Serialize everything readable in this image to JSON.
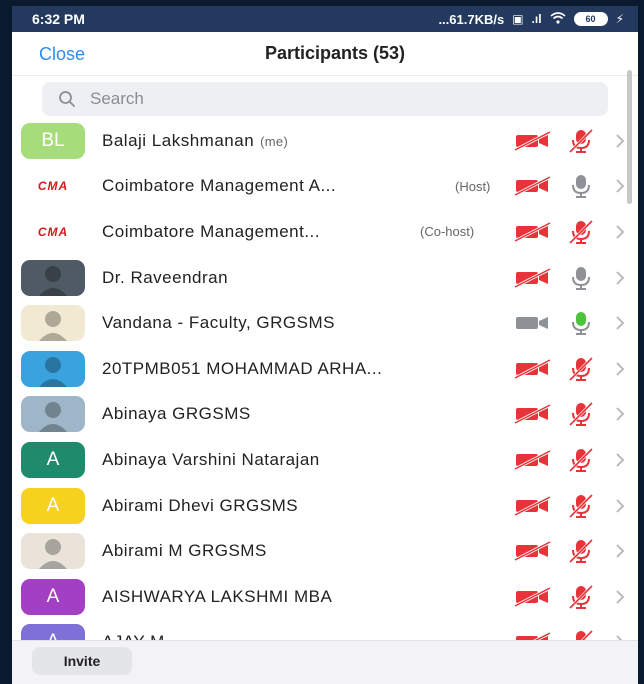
{
  "status": {
    "time": "6:32 PM",
    "network": "...61.7KB/s",
    "battery": "60"
  },
  "header": {
    "close_label": "Close",
    "title": "Participants (53)"
  },
  "search": {
    "placeholder": "Search"
  },
  "participants": [
    {
      "avatar": "BL",
      "avatar_color": "#a6dd7a",
      "name": "Balaji Lakshmanan",
      "tag": "(me)",
      "video": "off",
      "audio": "muted"
    },
    {
      "avatar": "CMA",
      "avatar_color": "#ffffff",
      "name": "Coimbatore Management A...",
      "tag": "(Host)",
      "video": "off",
      "audio": "on"
    },
    {
      "avatar": "CMA",
      "avatar_color": "#ffffff",
      "name": "Coimbatore Management...",
      "tag": "(Co-host)",
      "video": "off",
      "audio": "muted"
    },
    {
      "avatar": "",
      "avatar_color": "#4f5a64",
      "name": "Dr. Raveendran",
      "tag": "",
      "video": "off",
      "audio": "on"
    },
    {
      "avatar": "",
      "avatar_color": "#f1e9d2",
      "name": "Vandana - Faculty, GRGSMS",
      "tag": "",
      "video": "on",
      "audio": "active"
    },
    {
      "avatar": "",
      "avatar_color": "#3aa3df",
      "name": "20TPMB051 MOHAMMAD ARHA...",
      "tag": "",
      "video": "off",
      "audio": "muted"
    },
    {
      "avatar": "",
      "avatar_color": "#9fb6c8",
      "name": "Abinaya GRGSMS",
      "tag": "",
      "video": "off",
      "audio": "muted"
    },
    {
      "avatar": "A",
      "avatar_color": "#1f8a6c",
      "name": "Abinaya Varshini Natarajan",
      "tag": "",
      "video": "off",
      "audio": "muted"
    },
    {
      "avatar": "A",
      "avatar_color": "#f6d11e",
      "name": "Abirami  Dhevi GRGSMS",
      "tag": "",
      "video": "off",
      "audio": "muted"
    },
    {
      "avatar": "",
      "avatar_color": "#e9e3da",
      "name": "Abirami M GRGSMS",
      "tag": "",
      "video": "off",
      "audio": "muted"
    },
    {
      "avatar": "A",
      "avatar_color": "#a23fc2",
      "name": "AISHWARYA LAKSHMI MBA",
      "tag": "",
      "video": "off",
      "audio": "muted"
    },
    {
      "avatar": "A",
      "avatar_color": "#7d70d6",
      "name": "AJAY M",
      "tag": "",
      "video": "off",
      "audio": "muted"
    }
  ],
  "footer": {
    "invite_label": "Invite"
  },
  "colors": {
    "accent": "#2d8cf0",
    "muted_red": "#e8333a",
    "active_green": "#4cc43d",
    "neutral_gray": "#8e9196"
  }
}
